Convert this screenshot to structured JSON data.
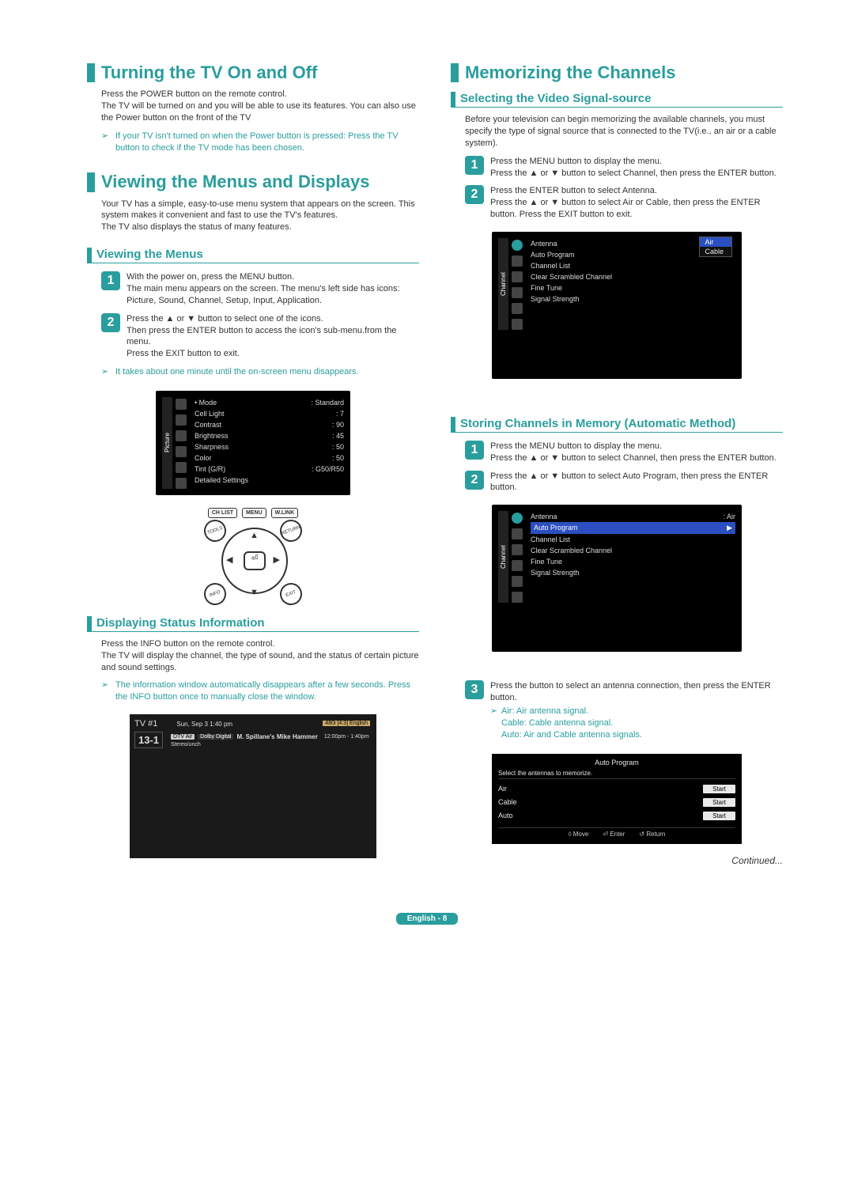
{
  "left": {
    "h1a": "Turning the TV On and Off",
    "p1": "Press the POWER button on the remote control.\nThe TV will be turned on and you will be able to use its features. You can also use the Power button on the front of the TV",
    "note1": "If your TV isn't turned on when the Power button is pressed: Press the TV button to check if the TV mode has been chosen.",
    "h1b": "Viewing the Menus and Displays",
    "p2": "Your TV has a simple, easy-to-use menu system that appears on the screen. This system makes it convenient and fast to use the TV's features.\nThe TV also displays the status of many features.",
    "sub1": "Viewing the Menus",
    "step1": "With the power on, press the MENU button.\nThe main menu appears on the screen. The menu's left side has icons: Picture, Sound, Channel, Setup, Input, Application.",
    "step2": "Press the ▲ or ▼ button to select one of the icons.\nThen press the ENTER button to access the icon's sub-menu.from the menu.\nPress the EXIT button to exit.",
    "note2": "It takes about one minute until the on-screen menu disappears.",
    "osd_picture": {
      "side": "Picture",
      "items": [
        {
          "k": "• Mode",
          "v": ": Standard"
        },
        {
          "k": "Cell Light",
          "v": ": 7"
        },
        {
          "k": "Contrast",
          "v": ": 90"
        },
        {
          "k": "Brightness",
          "v": ": 45"
        },
        {
          "k": "Sharpness",
          "v": ": 50"
        },
        {
          "k": "Color",
          "v": ": 50"
        },
        {
          "k": "Tint (G/R)",
          "v": ": G50/R50"
        },
        {
          "k": "Detailed Settings",
          "v": ""
        }
      ]
    },
    "remote_btns": [
      "CH LIST",
      "MENU",
      "W.LINK"
    ],
    "remote_labels": {
      "tools": "TOOLS",
      "return": "RETURN",
      "info": "INFO",
      "exit": "EXIT"
    },
    "sub2": "Displaying Status Information",
    "p3": "Press the INFO button on the remote control.\nThe TV will display the channel, the type of sound, and the status of certain picture and sound settings.",
    "note3": "The information window automatically disappears after a few seconds. Press the INFO button once to manually close the window.",
    "info_osd": {
      "tv": "TV #1",
      "dt": "Sun, Sep 3   1:40 pm",
      "dtvair": "DTV Air",
      "dd": "Dolby Digital",
      "show": "M. Spillane's Mike Hammer",
      "time": "12:00pm - 1:40pm",
      "ch": "13-1",
      "sub": "Stereo/unch",
      "tr": "480i [4:3] English"
    }
  },
  "right": {
    "h1": "Memorizing the Channels",
    "sub1": "Selecting the Video Signal-source",
    "p1": "Before your television can begin memorizing the available channels, you must specify the type of signal source that is connected to the TV(i.e., an air or a cable system).",
    "step1": "Press the MENU button to display the menu.\nPress the ▲ or ▼ button to select Channel, then press the ENTER button.",
    "step2": "Press the ENTER button to select Antenna.\nPress the ▲ or ▼ button to select Air or Cable, then press the ENTER button. Press the EXIT button to exit.",
    "osd_channel": {
      "side": "Channel",
      "items": [
        "Antenna",
        "Auto Program",
        "Channel List",
        "Clear Scrambled Channel",
        "Fine Tune",
        "Signal Strength"
      ],
      "dd": [
        "Air",
        "Cable"
      ]
    },
    "sub2": "Storing Channels in Memory (Automatic Method)",
    "stepA": "Press the MENU button to display the menu.\nPress the ▲ or ▼ button to select Channel, then press the ENTER button.",
    "stepB": "Press the ▲ or ▼ button to select Auto Program, then press the ENTER button.",
    "osd_auto": {
      "side": "Channel",
      "antenna_val": ": Air",
      "items": [
        "Antenna",
        "Auto Program",
        "Channel List",
        "Clear Scrambled Channel",
        "Fine Tune",
        "Signal Strength"
      ]
    },
    "stepC": "Press the   button to select an antenna connection, then press the ENTER button.",
    "stepC_notes": {
      "air": "Air: Air antenna signal.",
      "cable": "Cable: Cable antenna signal.",
      "auto": "Auto: Air and Cable antenna signals."
    },
    "auto_prog": {
      "title": "Auto Program",
      "msg": "Select the antennas to memorize.",
      "rows": [
        "Air",
        "Cable",
        "Auto"
      ],
      "start": "Start",
      "footer": {
        "move": "◊ Move",
        "enter": "⏎ Enter",
        "return": "↺ Return"
      }
    },
    "continued": "Continued...",
    "footer": "English - 8"
  }
}
